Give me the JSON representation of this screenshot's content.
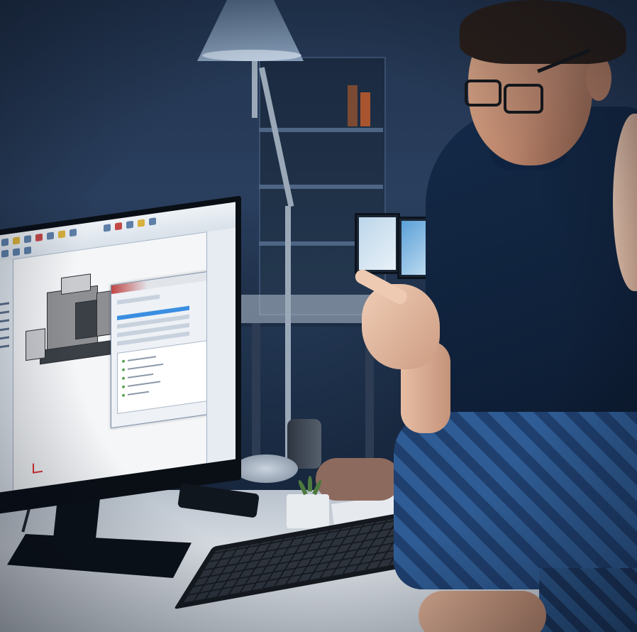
{
  "image": {
    "scene": "office-desk-cad-workstation"
  },
  "colors": {
    "background": "#18283f",
    "sweater": "#0f2039",
    "shirt_plaid": "#2f5c94",
    "desk": "#c8ced6",
    "screen": "#f4f6f8"
  },
  "icons": [
    "desk-lamp-icon",
    "monitor-icon",
    "keyboard-icon",
    "plant-icon",
    "phone-icon"
  ]
}
